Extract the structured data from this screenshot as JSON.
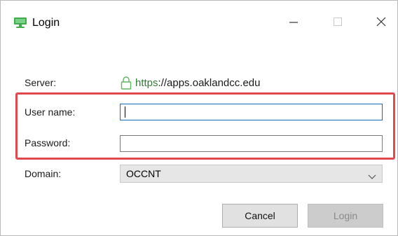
{
  "window": {
    "title": "Login"
  },
  "form": {
    "server_label": "Server:",
    "server_scheme": "https",
    "server_host": "://apps.oaklandcc.edu",
    "username_label": "User name:",
    "username_value": "",
    "password_label": "Password:",
    "password_value": "",
    "domain_label": "Domain:",
    "domain_value": "OCCNT"
  },
  "buttons": {
    "cancel": "Cancel",
    "login": "Login"
  },
  "icons": {
    "app": "monitor-icon",
    "lock": "lock-icon",
    "minimize": "minimize-icon",
    "maximize": "maximize-icon",
    "close": "close-icon",
    "dropdown": "chevron-down-icon"
  },
  "colors": {
    "accent": "#0f6cbd",
    "highlight": "#e04a4f",
    "secure": "#2e7d32",
    "brand": "#3fae49"
  }
}
